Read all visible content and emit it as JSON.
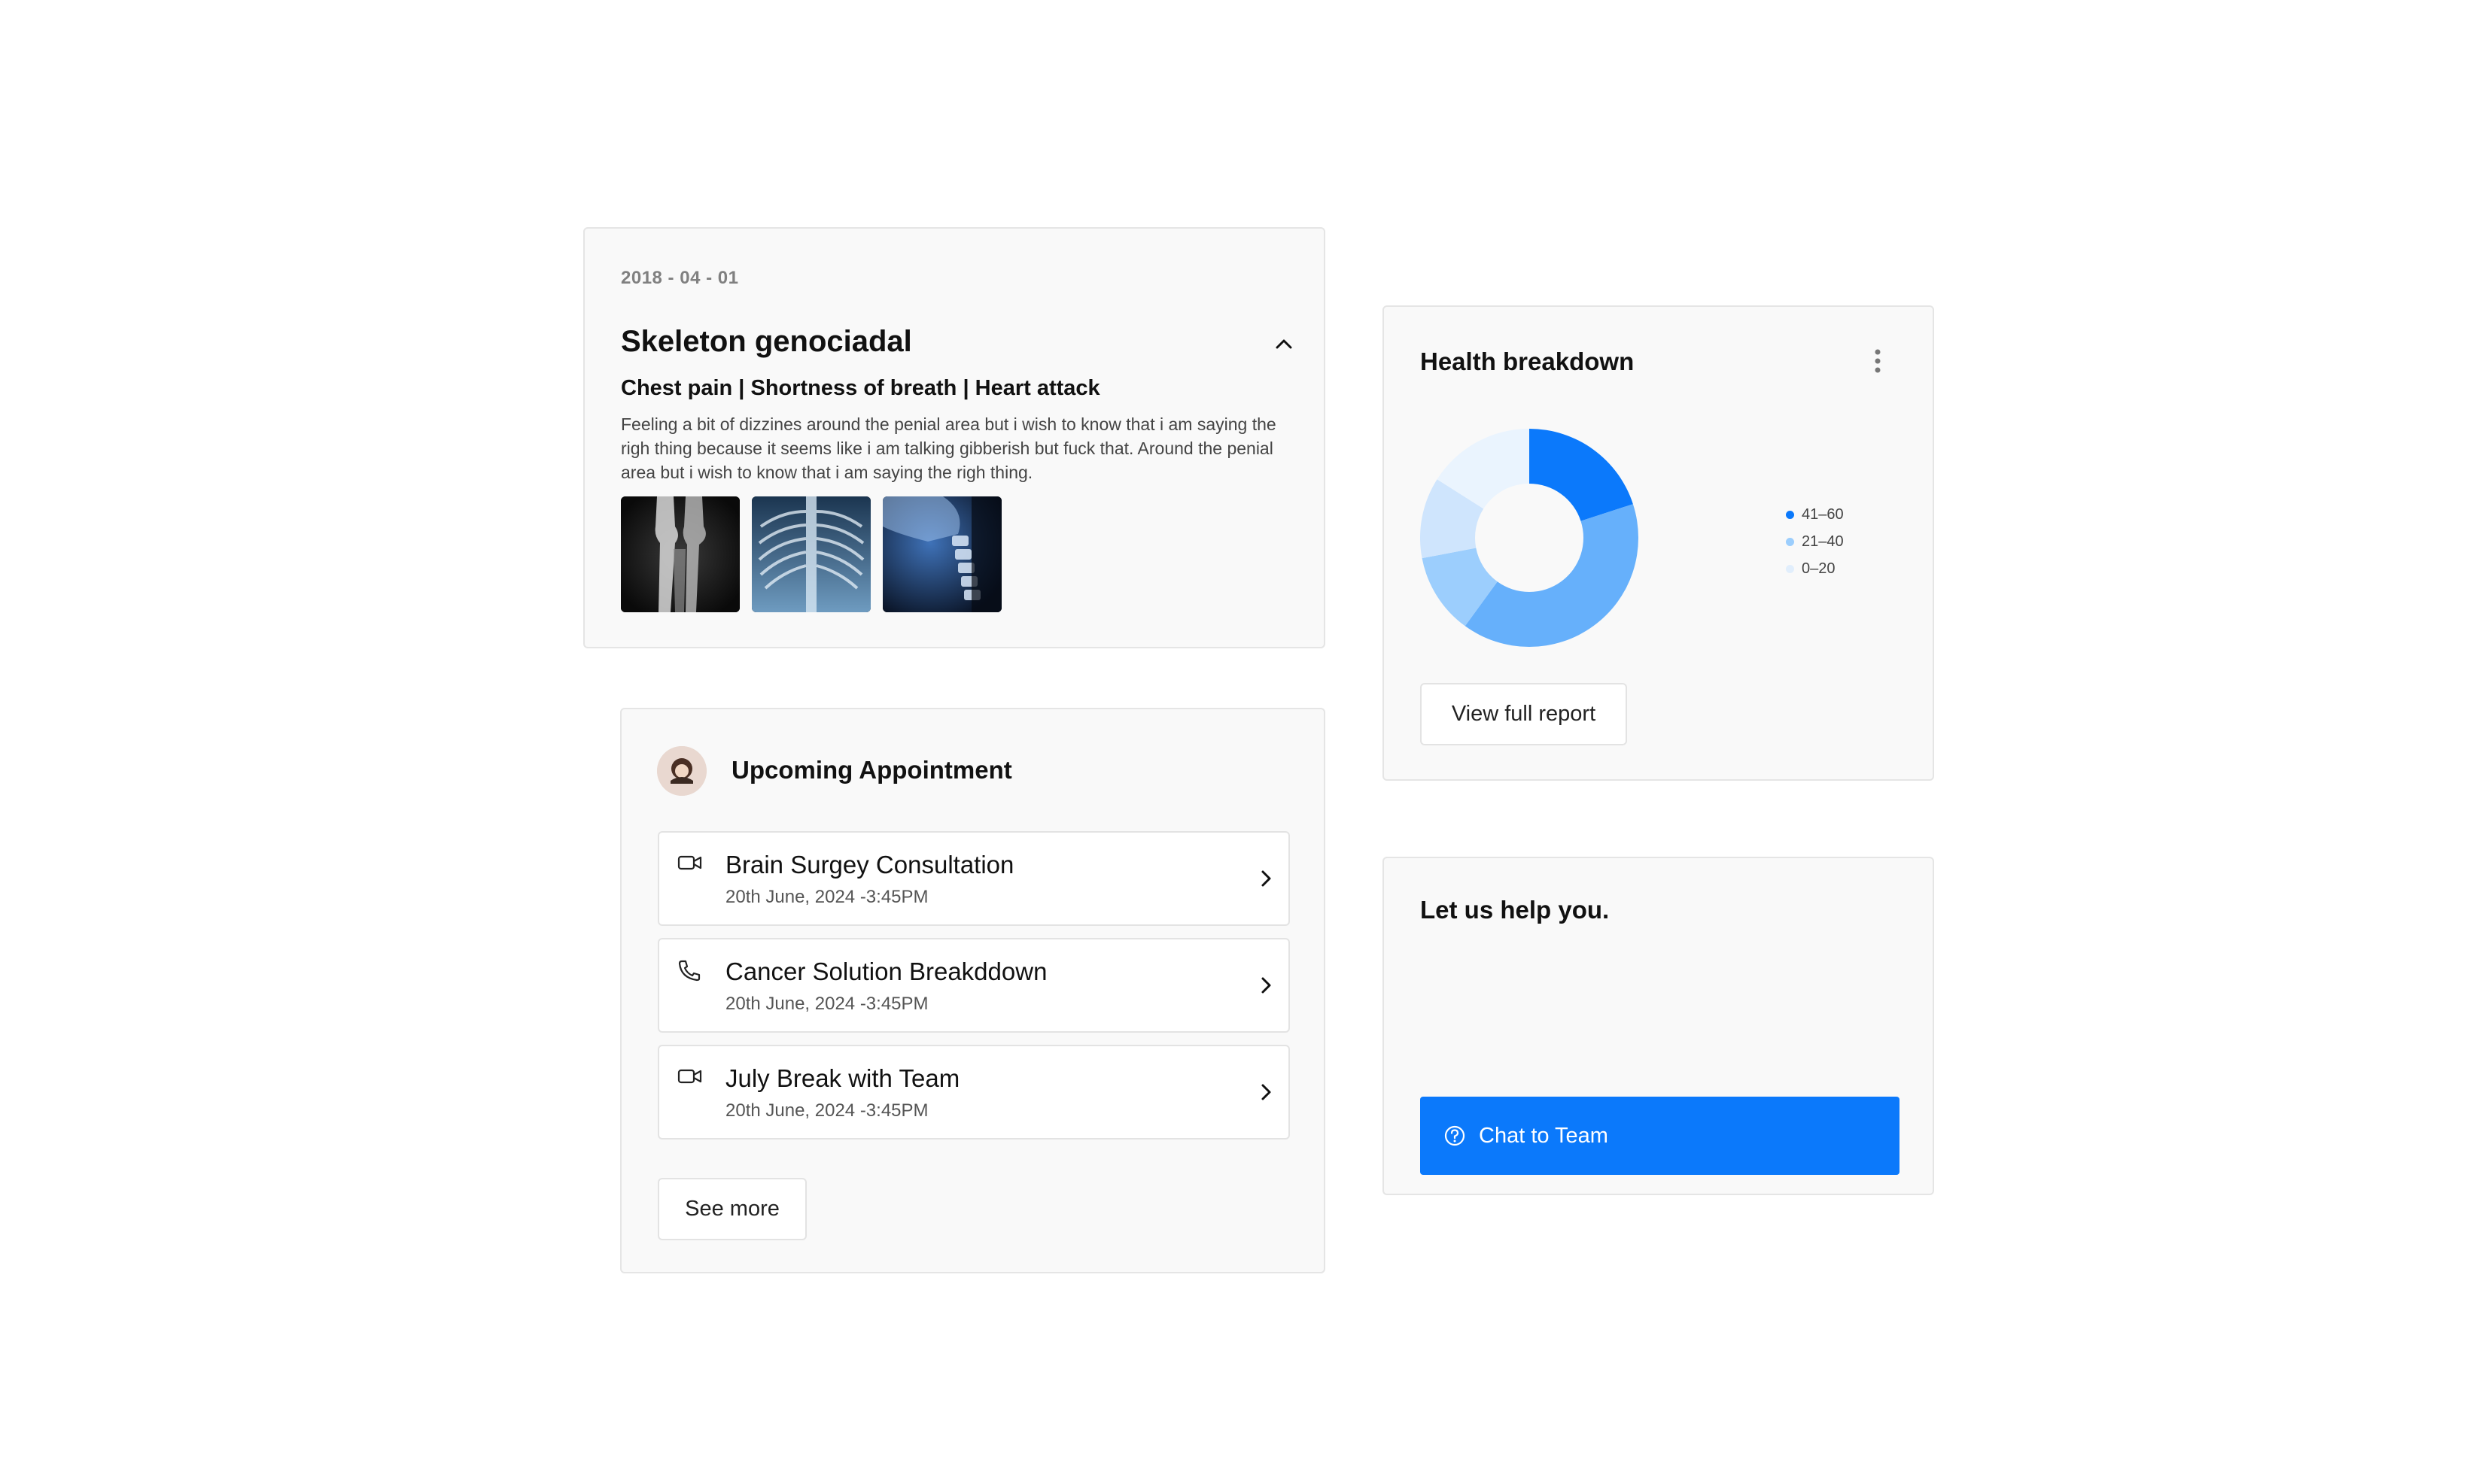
{
  "record": {
    "date": "2018 - 04 - 01",
    "title": "Skeleton genociadal",
    "symptoms": "Chest pain | Shortness of breath | Heart attack",
    "description": "Feeling a bit of dizzines around the penial area but i wish to know that i am saying the righ thing because it seems like i am talking gibberish but fuck that. Around the penial area but i wish to know that i am saying the righ thing.",
    "collapse_icon": "chevron-up-icon"
  },
  "appointments": {
    "heading": "Upcoming Appointment",
    "items": [
      {
        "title": "Brain Surgey Consultation",
        "time": "20th June, 2024 -3:45PM",
        "icon": "video-icon"
      },
      {
        "title": "Cancer Solution Breakddown",
        "time": "20th June, 2024 -3:45PM",
        "icon": "phone-icon"
      },
      {
        "title": "July Break with Team",
        "time": "20th June, 2024 -3:45PM",
        "icon": "video-icon"
      }
    ],
    "see_more_label": "See more"
  },
  "health": {
    "title": "Health breakdown",
    "menu_icon": "more-vertical-icon",
    "view_report_label": "View full report"
  },
  "chart_data": {
    "type": "pie",
    "categories": [
      "41–60",
      "21–40",
      "0–20"
    ],
    "legend_position": "right",
    "slices": [
      {
        "label": "41–60",
        "value": 20,
        "color": "#0b79fb"
      },
      {
        "label": "",
        "value": 40,
        "color": "#66b0fb"
      },
      {
        "label": "21–40",
        "value": 12,
        "color": "#9ccefd"
      },
      {
        "label": "",
        "value": 12,
        "color": "#cfe5fd"
      },
      {
        "label": "0–20",
        "value": 16,
        "color": "#eaf4fe"
      }
    ],
    "legend": [
      {
        "label": "41–60",
        "color": "#0b79fb"
      },
      {
        "label": "21–40",
        "color": "#9ccefd"
      },
      {
        "label": "0–20",
        "color": "#e1eefc"
      }
    ]
  },
  "help": {
    "title": "Let us help you.",
    "chat_label": "Chat to Team",
    "chat_icon": "help-circle-icon"
  },
  "colors": {
    "accent": "#0b79fb",
    "card_bg": "#f9f9f9",
    "border": "#e5e5e5"
  }
}
